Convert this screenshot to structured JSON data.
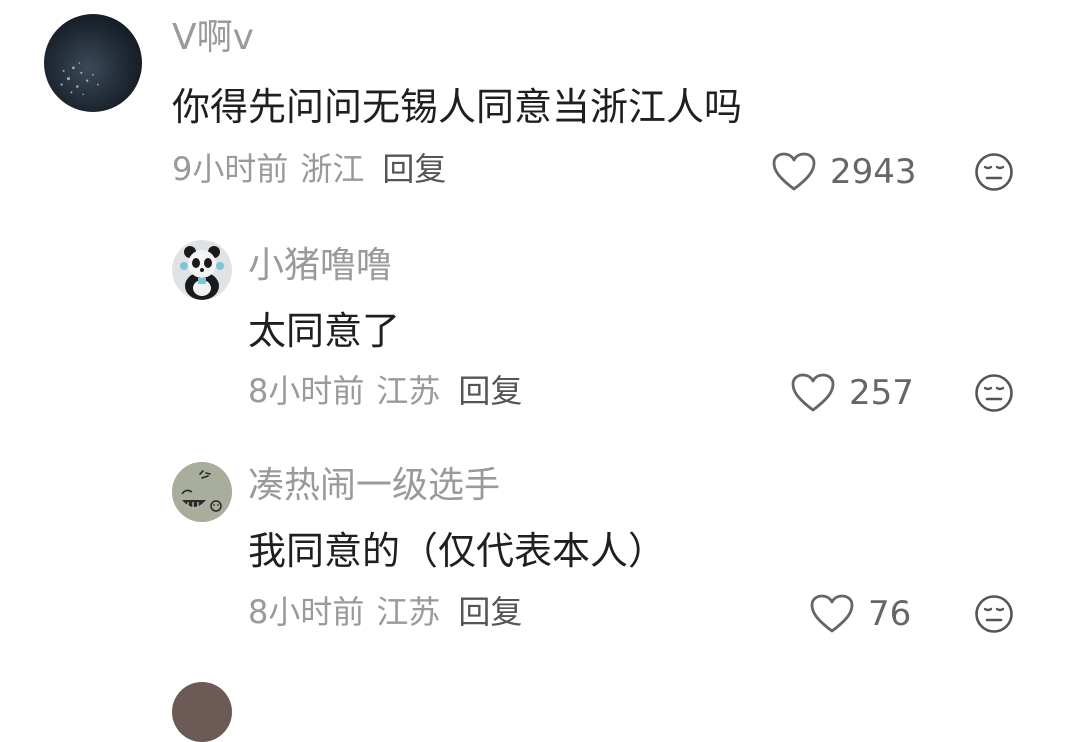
{
  "comments": [
    {
      "username": "V啊v",
      "text": "你得先问问无锡人同意当浙江人吗",
      "time": "9小时前",
      "location": "浙江",
      "reply_label": "回复",
      "likes": "2943",
      "avatar": "water-photo-avatar"
    },
    {
      "username": "小猪噜噜",
      "text": "太同意了",
      "time": "8小时前",
      "location": "江苏",
      "reply_label": "回复",
      "likes": "257",
      "avatar": "panda-avatar"
    },
    {
      "username": "凑热闹一级选手",
      "text": "我同意的（仅代表本人）",
      "time": "8小时前",
      "location": "江苏",
      "reply_label": "回复",
      "likes": "76",
      "avatar": "drawing-avatar"
    }
  ],
  "colors": {
    "username": "#9a9a9a",
    "text": "#1f1f1f",
    "meta": "#9a9a9a"
  }
}
